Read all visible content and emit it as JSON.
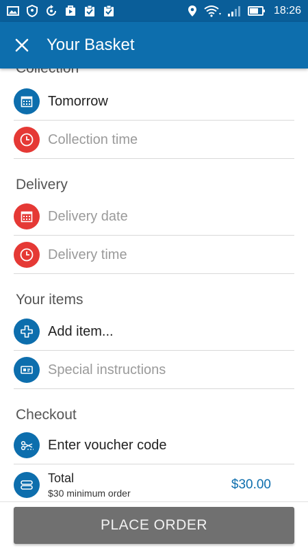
{
  "status_bar": {
    "time": "18:26"
  },
  "app_bar": {
    "title": "Your Basket",
    "close_icon": "close-icon"
  },
  "sections": {
    "collection": {
      "title": "Collection",
      "date_value": "Tomorrow",
      "time_placeholder": "Collection time"
    },
    "delivery": {
      "title": "Delivery",
      "date_placeholder": "Delivery date",
      "time_placeholder": "Delivery time"
    },
    "items": {
      "title": "Your items",
      "add_item": "Add item...",
      "special_instructions": "Special instructions"
    },
    "checkout": {
      "title": "Checkout",
      "voucher": "Enter voucher code",
      "total_label": "Total",
      "total_sub": "$30 minimum order",
      "total_amount": "$30.00"
    }
  },
  "place_order": {
    "label": "PLACE ORDER"
  },
  "colors": {
    "primary": "#0d6ead",
    "status_bar": "#0a5e99",
    "alert": "#e53935",
    "button": "#707070"
  }
}
